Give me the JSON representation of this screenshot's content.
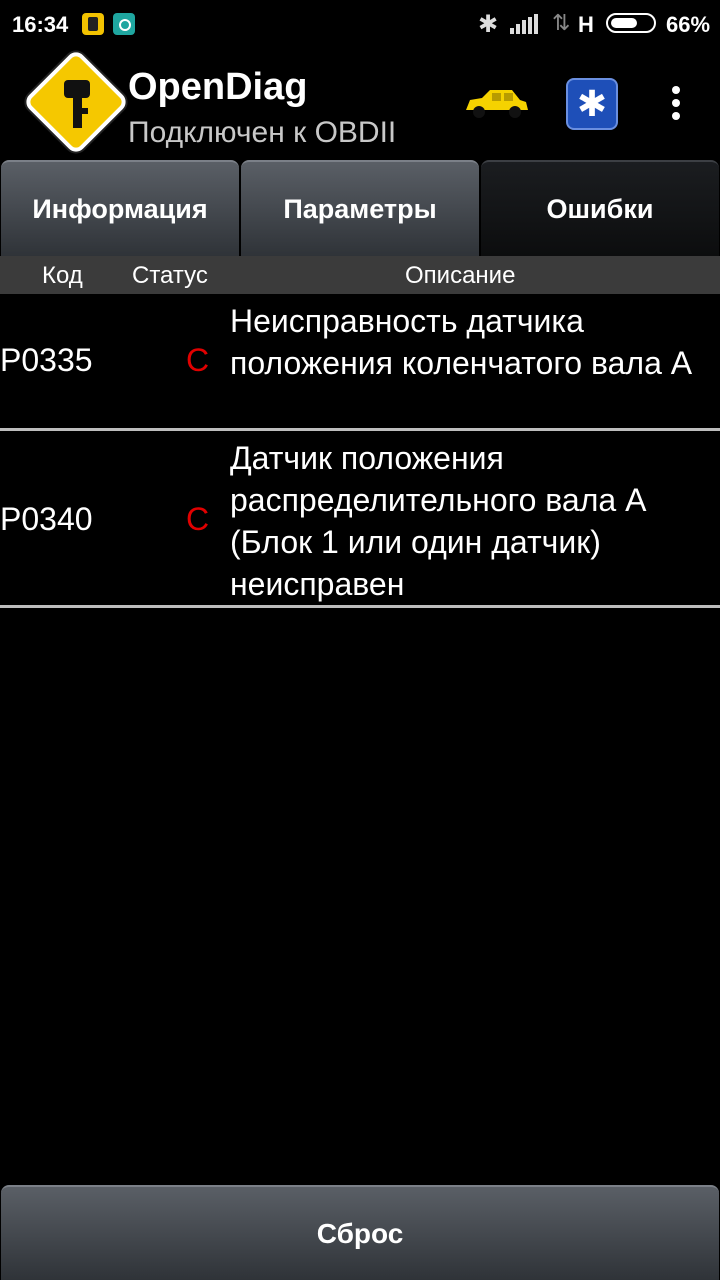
{
  "status_bar": {
    "time": "16:34",
    "network_type": "H",
    "battery_percent": "66%",
    "battery_level": 0.66,
    "icons": [
      "notification-icon",
      "notification-icon",
      "bluetooth-icon",
      "signal-icon",
      "data-icon",
      "battery-icon"
    ]
  },
  "app_bar": {
    "title": "OpenDiag",
    "subtitle": "Подключен к OBDII",
    "icons": [
      "app-logo-icon",
      "car-icon",
      "bluetooth-adapter-icon",
      "more-vert-icon"
    ],
    "accent_color": "#f5c800"
  },
  "tabs": [
    {
      "label": "Информация",
      "active": false
    },
    {
      "label": "Параметры",
      "active": false
    },
    {
      "label": "Ошибки",
      "active": true
    }
  ],
  "table": {
    "headers": {
      "code": "Код",
      "status": "Статус",
      "description": "Описание"
    },
    "rows": [
      {
        "code": "P0335",
        "status": "C",
        "description": "Неисправность датчика положения коленчатого вала А"
      },
      {
        "code": "P0340",
        "status": "C",
        "description": "Датчик положения распределительного вала А (Блок 1 или один датчик) неисправен"
      }
    ],
    "status_color": "#e10000"
  },
  "footer": {
    "reset_label": "Сброс"
  }
}
